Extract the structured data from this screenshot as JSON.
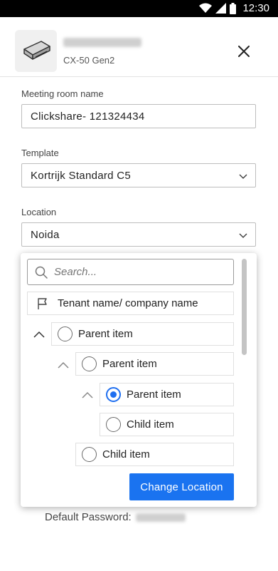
{
  "status_bar": {
    "time": "12:30"
  },
  "device": {
    "model": "CX-50 Gen2"
  },
  "form": {
    "room_name": {
      "label": "Meeting room name",
      "value": "Clickshare- 121324434"
    },
    "template": {
      "label": "Template",
      "value": "Kortrijk Standard C5"
    },
    "location": {
      "label": "Location",
      "value": "Noida"
    }
  },
  "location_dropdown": {
    "search_placeholder": "Search...",
    "tenant": "Tenant name/ company name",
    "tree": [
      {
        "label": "Parent item",
        "level": 0,
        "checked": false
      },
      {
        "label": "Parent item",
        "level": 1,
        "checked": false
      },
      {
        "label": "Parent item",
        "level": 2,
        "checked": true
      },
      {
        "label": "Child item",
        "level": 2,
        "checked": false
      },
      {
        "label": "Child item",
        "level": 1,
        "checked": false
      }
    ],
    "button": "Change Location"
  },
  "footer": {
    "default_password_label": "Default Password:"
  },
  "colors": {
    "accent": "#1a73f0"
  }
}
